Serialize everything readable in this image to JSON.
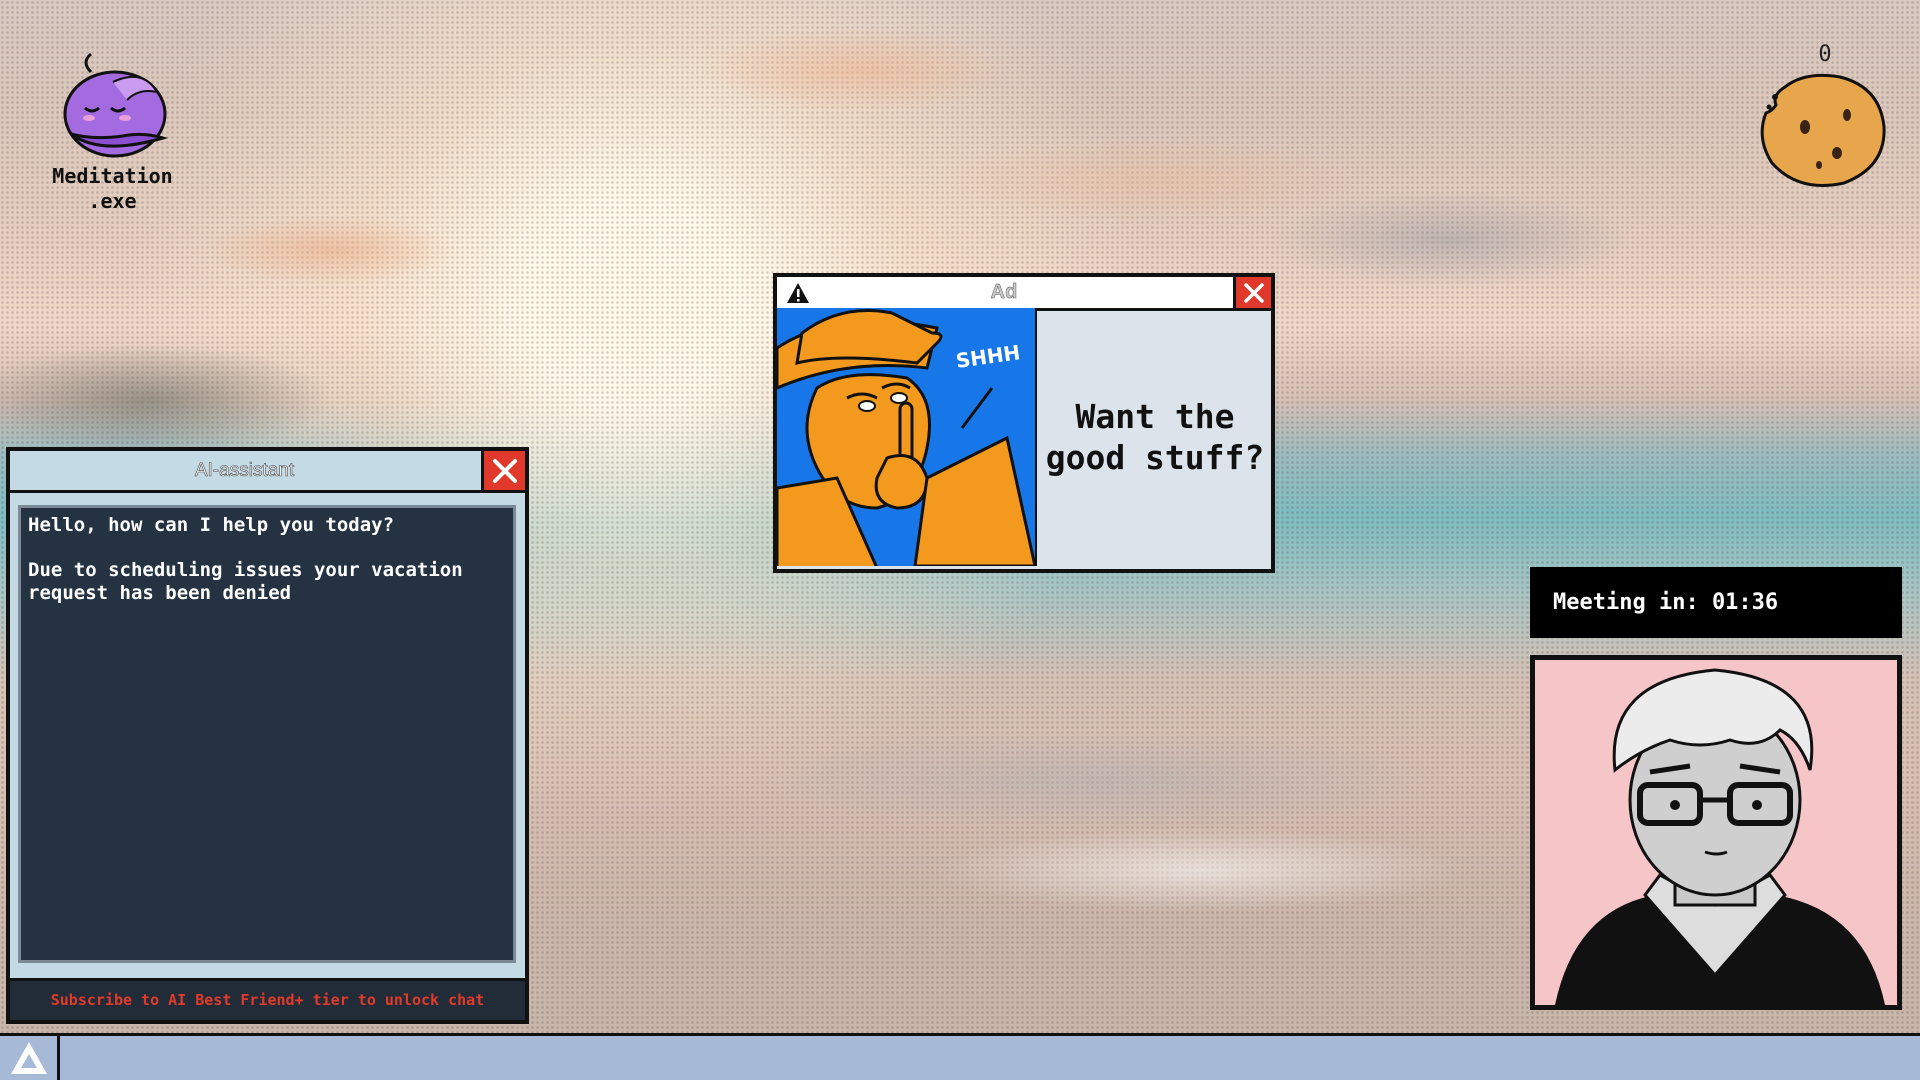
{
  "desktop": {
    "meditation_app": {
      "label": "Meditation\n.exe",
      "icon": "meditation-blob-icon"
    },
    "cookie_counter": {
      "count": "0",
      "icon": "cookie-icon"
    }
  },
  "ai_assistant": {
    "title": "AI-assistant",
    "messages": [
      "Hello, how can I help you today?",
      "Due to scheduling issues your vacation request has been denied"
    ],
    "footer": "Subscribe to AI Best Friend+ tier to unlock chat"
  },
  "ad_popup": {
    "title": "Ad",
    "art_text": "SHHH",
    "headline": "Want the good stuff?"
  },
  "meeting": {
    "label": "Meeting in: 01:36"
  },
  "taskbar": {
    "start_icon": "triangle-logo-icon"
  },
  "colors": {
    "close_red": "#e0392b",
    "chat_bg": "#243242",
    "window_frame": "#c4dbe6",
    "subscribe_text": "#e13a2a",
    "taskbar": "#a6b9d6",
    "webcam_bg": "#f6c5c8",
    "ad_art_blue": "#1877e8",
    "ad_art_orange": "#f39a1e"
  }
}
